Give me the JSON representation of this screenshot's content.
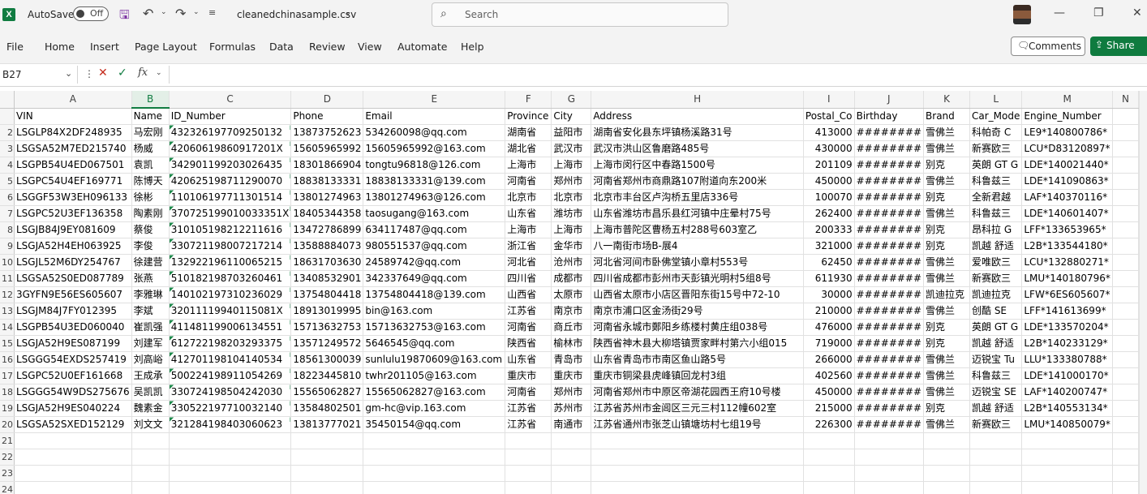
{
  "titlebar": {
    "app_icon": "excel-icon",
    "autosave_label": "AutoSave",
    "autosave_state": "Off",
    "filename": "cleanedchinasample.csv",
    "search_placeholder": "Search"
  },
  "menu": [
    "File",
    "Home",
    "Insert",
    "Page Layout",
    "Formulas",
    "Data",
    "Review",
    "View",
    "Automate",
    "Help"
  ],
  "actions": {
    "comments": "Comments",
    "share": "Share"
  },
  "formula_bar": {
    "name_box": "B27",
    "formula": "",
    "fx_symbol": "fx"
  },
  "selected_column": "B",
  "columns": [
    "A",
    "B",
    "C",
    "D",
    "E",
    "F",
    "G",
    "H",
    "I",
    "J",
    "K",
    "L",
    "M",
    "N"
  ],
  "rows": [
    {
      "row": "",
      "cells": [
        "VIN",
        "Name",
        "ID_Number",
        "Phone",
        "Email",
        "Province",
        "City",
        "Address",
        "Postal_Co",
        "Birthday",
        "Brand",
        "Car_Mode",
        "Engine_Number",
        ""
      ]
    },
    {
      "row": "2",
      "cells": [
        "LSGLP84X2DF248935",
        "马宏刚",
        "43232619770925013‍2",
        "13873752623",
        "534260098@qq.com",
        "湖南省",
        "益阳市",
        "湖南省安化县东坪镇杨溪路31号",
        "413000",
        "########",
        "雪佛兰",
        "科帕奇 C",
        "LE9*140800786*",
        ""
      ]
    },
    {
      "row": "3",
      "cells": [
        "LSGSA52M7ED215740",
        "杨威",
        "420606198609172 01X",
        "15605965992",
        "15605965992@163.com",
        "湖北省",
        "武汉市",
        "武汉市洪山区鲁磨路485号",
        "430000",
        "########",
        "雪佛兰",
        "新赛欧三",
        "LCU*D83120897*",
        ""
      ]
    },
    {
      "row": "4",
      "cells": [
        "LSGPB54U4ED067501",
        "袁凯",
        "342901199203026435",
        "18301866904",
        "tongtu96818@126.com",
        "上海市",
        "上海市",
        "上海市闵行区中春路1500号",
        "201109",
        "########",
        "别克",
        "英朗 GT G",
        "LDE*140021440*",
        ""
      ]
    },
    {
      "row": "5",
      "cells": [
        "LSGPC54U4EF169771",
        "陈博天",
        "420625198711290070",
        "18838133331",
        "18838133331@139.com",
        "河南省",
        "郑州市",
        "河南省郑州市商鼎路107附道向东200米",
        "450000",
        "########",
        "雪佛兰",
        "科鲁兹三",
        "LDE*141090863*",
        ""
      ]
    },
    {
      "row": "6",
      "cells": [
        "LSGGF53W3EH096133",
        "徐彬",
        "110106197711301514",
        "13801274963",
        "13801274963@126.com",
        "北京市",
        "北京市",
        "北京市丰台区卢沟桥五里店336号",
        "100070",
        "########",
        "别克",
        "全新君越",
        "LAF*140370116*",
        ""
      ]
    },
    {
      "row": "7",
      "cells": [
        "LSGPC52U3EF136358",
        "陶素刚",
        "370725199010033351X",
        "18405344358",
        "taosugang@163.com",
        "山东省",
        "潍坊市",
        "山东省潍坊市昌乐县红河镇中庄晕村75号",
        "262400",
        "########",
        "雪佛兰",
        "科鲁兹三",
        "LDE*140601407*",
        ""
      ]
    },
    {
      "row": "8",
      "cells": [
        "LSGJB84J9EY081609",
        "蔡俊",
        "310105198212211616",
        "13472786899",
        "634117487@qq.com",
        "上海市",
        "上海市",
        "上海市普陀区曹杨五村288号603室乙",
        "200333",
        "########",
        "别克",
        "昂科拉 G",
        "LFF*133653965*",
        ""
      ]
    },
    {
      "row": "9",
      "cells": [
        "LSGJA52H4EH063925",
        "李俊",
        "330721198007217214",
        "13588884073",
        "980551537@qq.com",
        "浙江省",
        "金华市",
        "八一南街市场B-展4",
        "321000",
        "########",
        "别克",
        "凯越 舒适",
        "L2B*133544180*",
        ""
      ]
    },
    {
      "row": "10",
      "cells": [
        "LSGJL52M6DY254767",
        "徐建营",
        "132922196110065215",
        "18631703630",
        "24589742@qq.com",
        "河北省",
        "沧州市",
        "河北省河间市卧佛堂镇小章村553号",
        "62450",
        "########",
        "雪佛兰",
        "爱唯欧三",
        "LCU*132880271*",
        ""
      ]
    },
    {
      "row": "11",
      "cells": [
        "LSGSA52S0ED087789",
        "张燕",
        "510182198703260461",
        "13408532901",
        "342337649@qq.com",
        "四川省",
        "成都市",
        "四川省成都市彭州市天彭镇光明村5组8号",
        "611930",
        "########",
        "雪佛兰",
        "新赛欧三",
        "LMU*140180796*",
        ""
      ]
    },
    {
      "row": "12",
      "cells": [
        "3GYFN9E56ES605607",
        "李雅琳",
        "140102197310236029",
        "13754804418",
        "13754804418@139.com",
        "山西省",
        "太原市",
        "山西省太原市小店区晋阳东街15号中72-10",
        "30000",
        "########",
        "凯迪拉克",
        "凯迪拉克",
        "LFW*6ES605607*",
        ""
      ]
    },
    {
      "row": "13",
      "cells": [
        "LSGJM84J7FY012395",
        "李斌",
        "320111199401150 81X",
        "18913019995",
        "bin@163.com",
        "江苏省",
        "南京市",
        "南京市浦口区金汤街29号",
        "210000",
        "########",
        "雪佛兰",
        "创酷 SE",
        "LFF*141613699*",
        ""
      ]
    },
    {
      "row": "14",
      "cells": [
        "LSGPB54U3ED060040",
        "崔凯强",
        "411481199006134551",
        "15713632753",
        "15713632753@163.com",
        "河南省",
        "商丘市",
        "河南省永城市鄭阳乡练楼村黄庄组038号",
        "476000",
        "########",
        "别克",
        "英朗 GT G",
        "LDE*133570204*",
        ""
      ]
    },
    {
      "row": "15",
      "cells": [
        "LSGJA52H9ES087199",
        "刘建军",
        "612722198203293375",
        "13571249572",
        "5646545@qq.com",
        "陕西省",
        "榆林市",
        "陕西省神木县大柳塔镇贾家畔村第六小组015",
        "719000",
        "########",
        "别克",
        "凯越 舒适",
        "L2B*140233129*",
        ""
      ]
    },
    {
      "row": "16",
      "cells": [
        "LSGGG54EXDS257419",
        "刘高峪",
        "412701198104140534",
        "18561300039",
        "sunlulu19870609@163.com",
        "山东省",
        "青岛市",
        "山东省青岛市市南区鱼山路5号",
        "266000",
        "########",
        "雪佛兰",
        "迈锐宝 Tu",
        "LLU*133380788*",
        ""
      ]
    },
    {
      "row": "17",
      "cells": [
        "LSGPC52U0EF161668",
        "王成承",
        "500224198911054269",
        "18223445810",
        "twhr201105@163.com",
        "重庆市",
        "重庆市",
        "重庆市铜梁县虎峰镇回龙村3组",
        "402560",
        "########",
        "雪佛兰",
        "科鲁兹三",
        "LDE*141000170*",
        ""
      ]
    },
    {
      "row": "18",
      "cells": [
        "LSGGG54W9DS275676",
        "吴凯凯",
        "330724198504242030",
        "15565062827",
        "15565062827@163.com",
        "河南省",
        "郑州市",
        "河南省郑州市中原区帝湖花园西王府10号楼",
        "450000",
        "########",
        "雪佛兰",
        "迈锐宝 SE",
        "LAF*140200747*",
        ""
      ]
    },
    {
      "row": "19",
      "cells": [
        "LSGJA52H9ES040224",
        "魏素金",
        "330522197710032140",
        "13584802501",
        "gm-hc@vip.163.com",
        "江苏省",
        "苏州市",
        "江苏省苏州市金阊区三元三村112幢602室",
        "215000",
        "########",
        "别克",
        "凯越 舒适",
        "L2B*140553134*",
        ""
      ]
    },
    {
      "row": "20",
      "cells": [
        "LSGSA52SXED152129",
        "刘文文",
        "321284198403060623",
        "13813777021",
        "35450154@qq.com",
        "江苏省",
        "南通市",
        "江苏省通州市张芝山镇塘坊村七组19号",
        "226300",
        "########",
        "雪佛兰",
        "新赛欧三",
        "LMU*140850079*",
        ""
      ]
    },
    {
      "row": "21",
      "cells": [
        "",
        "",
        "",
        "",
        "",
        "",
        "",
        "",
        "",
        "",
        "",
        "",
        "",
        ""
      ]
    },
    {
      "row": "22",
      "cells": [
        "",
        "",
        "",
        "",
        "",
        "",
        "",
        "",
        "",
        "",
        "",
        "",
        "",
        ""
      ]
    },
    {
      "row": "23",
      "cells": [
        "",
        "",
        "",
        "",
        "",
        "",
        "",
        "",
        "",
        "",
        "",
        "",
        "",
        ""
      ]
    },
    {
      "row": "24",
      "cells": [
        "",
        "",
        "",
        "",
        "",
        "",
        "",
        "",
        "",
        "",
        "",
        "",
        "",
        ""
      ]
    }
  ]
}
